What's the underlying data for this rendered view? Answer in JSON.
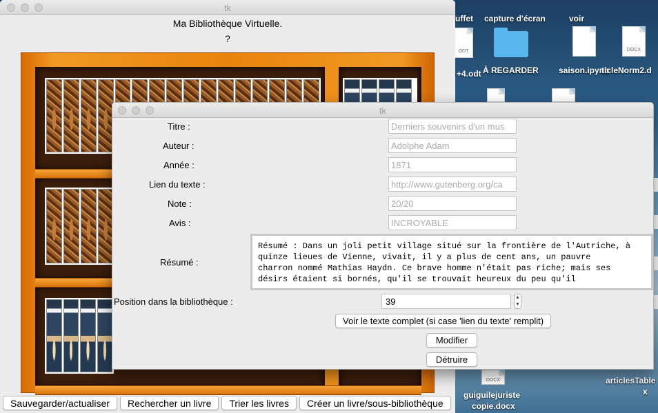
{
  "desktop": {
    "labels": [
      "uffet",
      "capture d'écran",
      "voir",
      "+4.odt",
      "À REGARDER",
      "saison.ipynb",
      "ticleNorm2.d",
      "guiguilejuriste",
      "copie.docx",
      "articlesTable",
      "x"
    ],
    "doc_tags": [
      "ODT",
      "DOCX",
      "DOCX"
    ]
  },
  "main_window": {
    "title": "tk",
    "heading": "Ma Bibliothèque Virtuelle.",
    "question": "?",
    "buttons": {
      "save": "Sauvegarder/actualiser",
      "search": "Rechercher un livre",
      "sort": "Trier les livres",
      "create": "Créer un livre/sous-bibliothèque"
    }
  },
  "detail_window": {
    "title": "tk",
    "labels": {
      "titre": "Titre :",
      "auteur": "Auteur :",
      "annee": "Année :",
      "lien": "Lien du texte :",
      "note": "Note :",
      "avis": "Avis :",
      "resume": "Résumé :",
      "position": "Position dans la bibliothèque :"
    },
    "values": {
      "titre": "Derniers souvenirs d'un mus",
      "auteur": "Adolphe Adam",
      "annee": "1871",
      "lien": "http://www.gutenberg.org/ca",
      "note": "20/20",
      "avis": "INCROYABLE",
      "resume_lines": [
        "Résumé : Dans un joli petit village situé sur la frontière de l'Autriche, à",
        "quinze lieues de Vienne, vivait, il y a plus de cent ans, un pauvre",
        "charron nommé Mathias Haydn. Ce brave homme n'était pas riche; mais ses",
        "désirs étaient si bornés, qu'il se trouvait heureux du peu qu'il"
      ],
      "position": "39"
    },
    "buttons": {
      "open_text": "Voir le texte complet (si case 'lien du texte' remplit)",
      "modify": "Modifier",
      "destroy": "Détruire"
    }
  }
}
